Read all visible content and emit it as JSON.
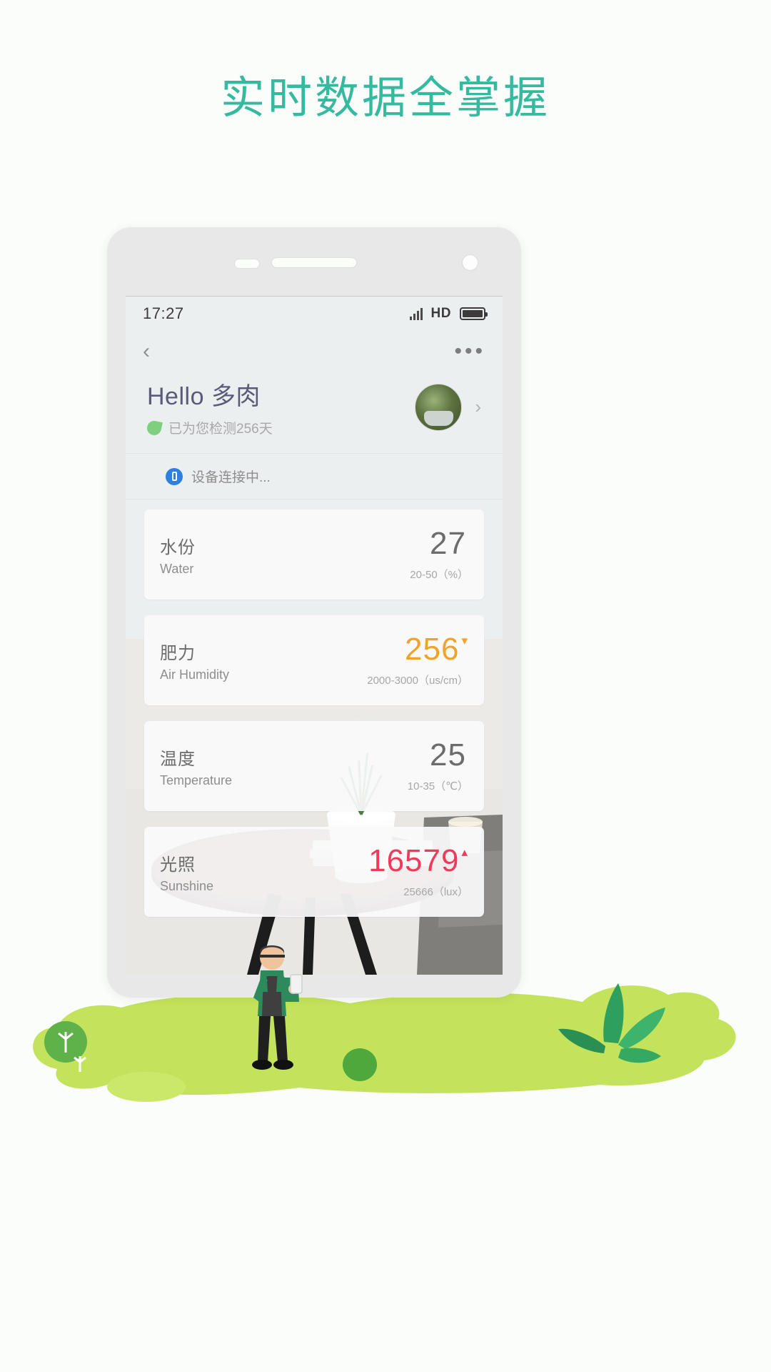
{
  "headline": "实时数据全掌握",
  "theme": {
    "accent": "#35baa0",
    "grass": "#c3e35c",
    "orange": "#f0a32a",
    "red": "#ef3b5b",
    "blue": "#2f7fe0"
  },
  "phone": {
    "statusbar": {
      "time": "17:27",
      "hd_label": "HD",
      "signal_icon": "signal-bars-icon",
      "battery_icon": "battery-icon"
    },
    "navbar": {
      "back_icon": "chevron-left-icon",
      "overflow_icon": "more-horizontal-icon"
    },
    "header": {
      "title": "Hello 多肉",
      "leaf_icon": "leaf-icon",
      "subtitle": "已为您检测256天",
      "avatar_name": "plant-avatar",
      "chevron_icon": "chevron-right-icon"
    },
    "connection": {
      "device_icon": "device-icon",
      "status_text": "设备连接中..."
    },
    "metrics": [
      {
        "cn": "水份",
        "en": "Water",
        "value": "27",
        "range": "20-50（%）",
        "color": "normal",
        "trend": ""
      },
      {
        "cn": "肥力",
        "en": "Air Humidity",
        "value": "256",
        "range": "2000-3000（us/cm）",
        "color": "orange",
        "trend": "▾"
      },
      {
        "cn": "温度",
        "en": "Temperature",
        "value": "25",
        "range": "10-35（℃）",
        "color": "normal",
        "trend": ""
      },
      {
        "cn": "光照",
        "en": "Sunshine",
        "value": "16579",
        "range": "25666（lux）",
        "color": "red",
        "trend": "▴"
      }
    ]
  }
}
